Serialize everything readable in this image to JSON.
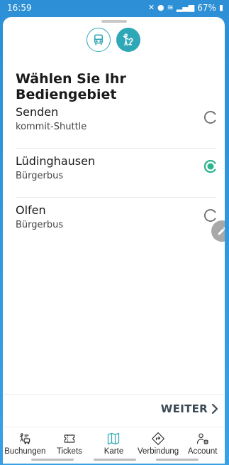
{
  "status_bar": {
    "time": "16:59",
    "battery": "67%"
  },
  "screen": {
    "title": "Wählen Sie Ihr Bediengebiet"
  },
  "areas": [
    {
      "name": "Senden",
      "type": "kommit-Shuttle",
      "selected": false
    },
    {
      "name": "Lüdinghausen",
      "type": "Bürgerbus",
      "selected": true
    },
    {
      "name": "Olfen",
      "type": "Bürgerbus",
      "selected": false
    }
  ],
  "footer": {
    "next_label": "WEITER"
  },
  "tabs": [
    {
      "label": "Buchungen",
      "icon": "bookings-icon"
    },
    {
      "label": "Tickets",
      "icon": "ticket-icon"
    },
    {
      "label": "Karte",
      "icon": "map-icon"
    },
    {
      "label": "Verbindung",
      "icon": "route-icon"
    },
    {
      "label": "Account",
      "icon": "account-settings-icon"
    }
  ],
  "colors": {
    "accent": "#2ea7b7",
    "selected_radio": "#2bb58e",
    "status_bar": "#2d8fd6"
  }
}
